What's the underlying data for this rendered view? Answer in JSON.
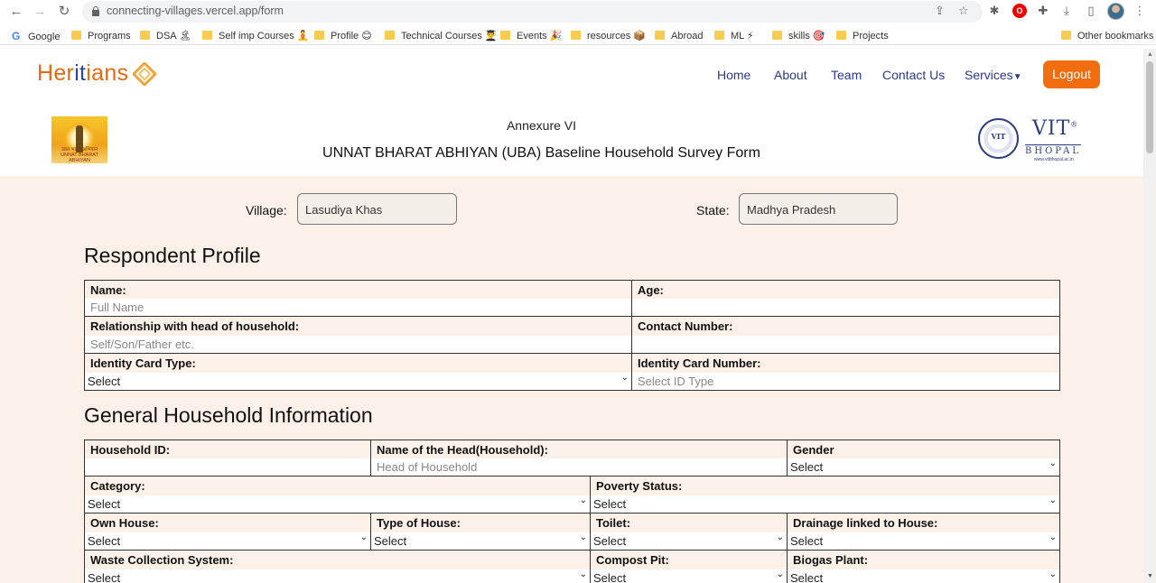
{
  "browser": {
    "url": "connecting-villages.vercel.app/form",
    "bookmarks": [
      "Google",
      "Programs",
      "DSA 🏝",
      "Self imp Courses 🧘",
      "Profile 😊",
      "Technical Courses 👨‍🎓",
      "Events 🎉",
      "resources 📦",
      "Abroad",
      "ML ⚡",
      "skills 🎯",
      "Projects"
    ],
    "other_bookmarks": "Other bookmarks",
    "icons": [
      "back-icon",
      "forward-icon",
      "reload-icon",
      "lock-icon",
      "share-icon",
      "star-icon",
      "extension-icon",
      "opera-icon",
      "puzzle-icon",
      "download-icon",
      "sidepanel-icon",
      "profile-avatar",
      "menu-icon"
    ]
  },
  "header": {
    "logo_prefix": "Her",
    "logo_middle": "it",
    "logo_suffix": "ians",
    "nav": [
      "Home",
      "About",
      "Team",
      "Contact Us",
      "Services"
    ],
    "logout": "Logout",
    "accent": "#f26d0e",
    "nav_color": "#2c3a8a"
  },
  "title_block": {
    "annexure": "Annexure VI",
    "form_title": "UNNAT BHARAT ABHIYAN (UBA) Baseline Household Survey Form",
    "uba_caption": "उन्नत भारत अभियान",
    "uba_caption_en": "UNNAT BHARAT ABHIYAN",
    "vit_word": "VIT",
    "vit_reg": "®",
    "vit_city": "BHOPAL",
    "vit_url": "www.vitbhopal.ac.in",
    "vit_seal_text": "VIT"
  },
  "location": {
    "village_label": "Village:",
    "village_value": "Lasudiya Khas",
    "state_label": "State:",
    "state_value": "Madhya Pradesh"
  },
  "respondent": {
    "title": "Respondent Profile",
    "name_label": "Name:",
    "name_placeholder": "Full Name",
    "age_label": "Age:",
    "relation_label": "Relationship with head of household:",
    "relation_placeholder": "Self/Son/Father etc.",
    "contact_label": "Contact Number:",
    "id_type_label": "Identity Card Type:",
    "id_type_value": "Select",
    "id_number_label": "Identity Card Number:",
    "id_number_placeholder": "Select ID Type"
  },
  "household": {
    "title": "General Household Information",
    "household_id_label": "Household ID:",
    "head_name_label": "Name of the Head(Household):",
    "head_name_placeholder": "Head of Household",
    "gender_label": "Gender",
    "category_label": "Category:",
    "poverty_label": "Poverty Status:",
    "own_house_label": "Own House:",
    "house_type_label": "Type of House:",
    "toilet_label": "Toilet:",
    "drainage_label": "Drainage linked to House:",
    "waste_label": "Waste Collection System:",
    "compost_label": "Compost Pit:",
    "biogas_label": "Biogas Plant:",
    "select_text": "Select"
  }
}
